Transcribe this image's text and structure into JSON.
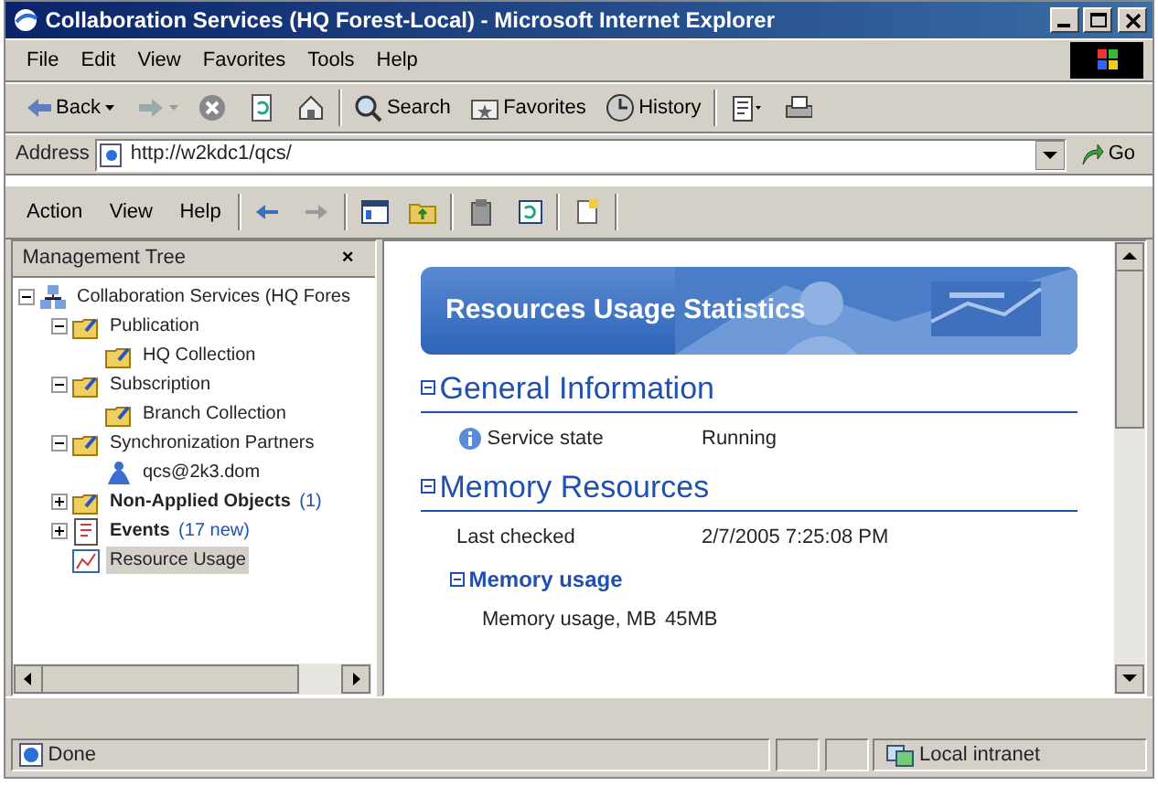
{
  "window": {
    "title": "Collaboration Services (HQ Forest-Local) - Microsoft Internet Explorer"
  },
  "menu": [
    "File",
    "Edit",
    "View",
    "Favorites",
    "Tools",
    "Help"
  ],
  "toolbar": [
    {
      "kind": "back",
      "label": "Back"
    },
    {
      "kind": "forward"
    },
    {
      "kind": "stop"
    },
    {
      "kind": "refresh"
    },
    {
      "kind": "home"
    },
    {
      "kind": "search",
      "label": "Search"
    },
    {
      "kind": "favorites",
      "label": "Favorites"
    },
    {
      "kind": "history",
      "label": "History"
    },
    {
      "kind": "edit"
    },
    {
      "kind": "print"
    }
  ],
  "address": {
    "label": "Address",
    "value": "http://w2kdc1/qcs/",
    "go": "Go"
  },
  "mmc_menu": [
    "Action",
    "View",
    "Help"
  ],
  "tree": {
    "title": "Management Tree",
    "close": "×",
    "items": [
      {
        "label": "Collaboration Services (HQ Fores",
        "kind": "root",
        "bold": false,
        "selected": false,
        "expanded": true,
        "children": [
          {
            "label": "Publication",
            "kind": "folder",
            "bold": false,
            "selected": false,
            "expanded": true,
            "children": [
              {
                "label": "HQ Collection",
                "kind": "folder",
                "bold": false,
                "selected": false
              }
            ]
          },
          {
            "label": "Subscription",
            "kind": "folder",
            "bold": false,
            "selected": false,
            "expanded": true,
            "children": [
              {
                "label": "Branch Collection",
                "kind": "folder",
                "bold": false,
                "selected": false
              }
            ]
          },
          {
            "label": "Synchronization Partners",
            "kind": "folder",
            "bold": false,
            "selected": false,
            "expanded": true,
            "children": [
              {
                "label": "qcs@2k3.dom",
                "kind": "user",
                "bold": false,
                "selected": false
              }
            ]
          },
          {
            "label": "Non-Applied Objects",
            "count": "(1)",
            "kind": "folder",
            "bold": true,
            "selected": false,
            "expanded": false
          },
          {
            "label": "Events",
            "count": "(17 new)",
            "kind": "events",
            "bold": true,
            "selected": false,
            "expanded": false
          },
          {
            "label": "Resource Usage",
            "kind": "chart",
            "bold": false,
            "selected": true
          }
        ]
      }
    ]
  },
  "content": {
    "banner": "Resources Usage Statistics",
    "sections": [
      {
        "heading": "General Information",
        "rows": [
          {
            "label": "Service state",
            "value": "Running",
            "kind": "info"
          }
        ]
      },
      {
        "heading": "Memory Resources",
        "rows": [
          {
            "label": "Last checked",
            "value": "2/7/2005 7:25:08 PM",
            "kind": "plain"
          }
        ],
        "subsections": [
          {
            "heading": "Memory usage",
            "rows": [
              {
                "label": "Memory usage, MB",
                "value": "45MB",
                "kind": "plain"
              }
            ]
          }
        ]
      }
    ]
  },
  "status_bar": {
    "text": "Done",
    "zone": "Local intranet"
  }
}
